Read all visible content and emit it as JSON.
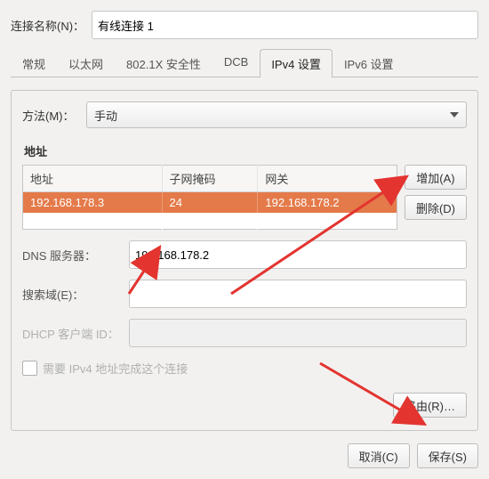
{
  "header": {
    "name_label": "连接名称(N)：",
    "name_value": "有线连接 1"
  },
  "tabs": [
    "常规",
    "以太网",
    "802.1X 安全性",
    "DCB",
    "IPv4 设置",
    "IPv6 设置"
  ],
  "active_tab": 4,
  "method": {
    "label": "方法(M)：",
    "value": "手动"
  },
  "addresses": {
    "title": "地址",
    "columns": [
      "地址",
      "子网掩码",
      "网关"
    ],
    "rows": [
      {
        "addr": "192.168.178.3",
        "mask": "24",
        "gw": "192.168.178.2"
      }
    ],
    "add_btn": "增加(A)",
    "del_btn": "删除(D)"
  },
  "dns": {
    "label": "DNS 服务器：",
    "value": "192.168.178.2"
  },
  "search": {
    "label": "搜索域(E)：",
    "value": ""
  },
  "dhcp": {
    "label": "DHCP 客户端 ID：",
    "value": ""
  },
  "require4": "需要 IPv4 地址完成这个连接",
  "route_btn": "路由(R)…",
  "footer": {
    "cancel": "取消(C)",
    "save": "保存(S)"
  }
}
